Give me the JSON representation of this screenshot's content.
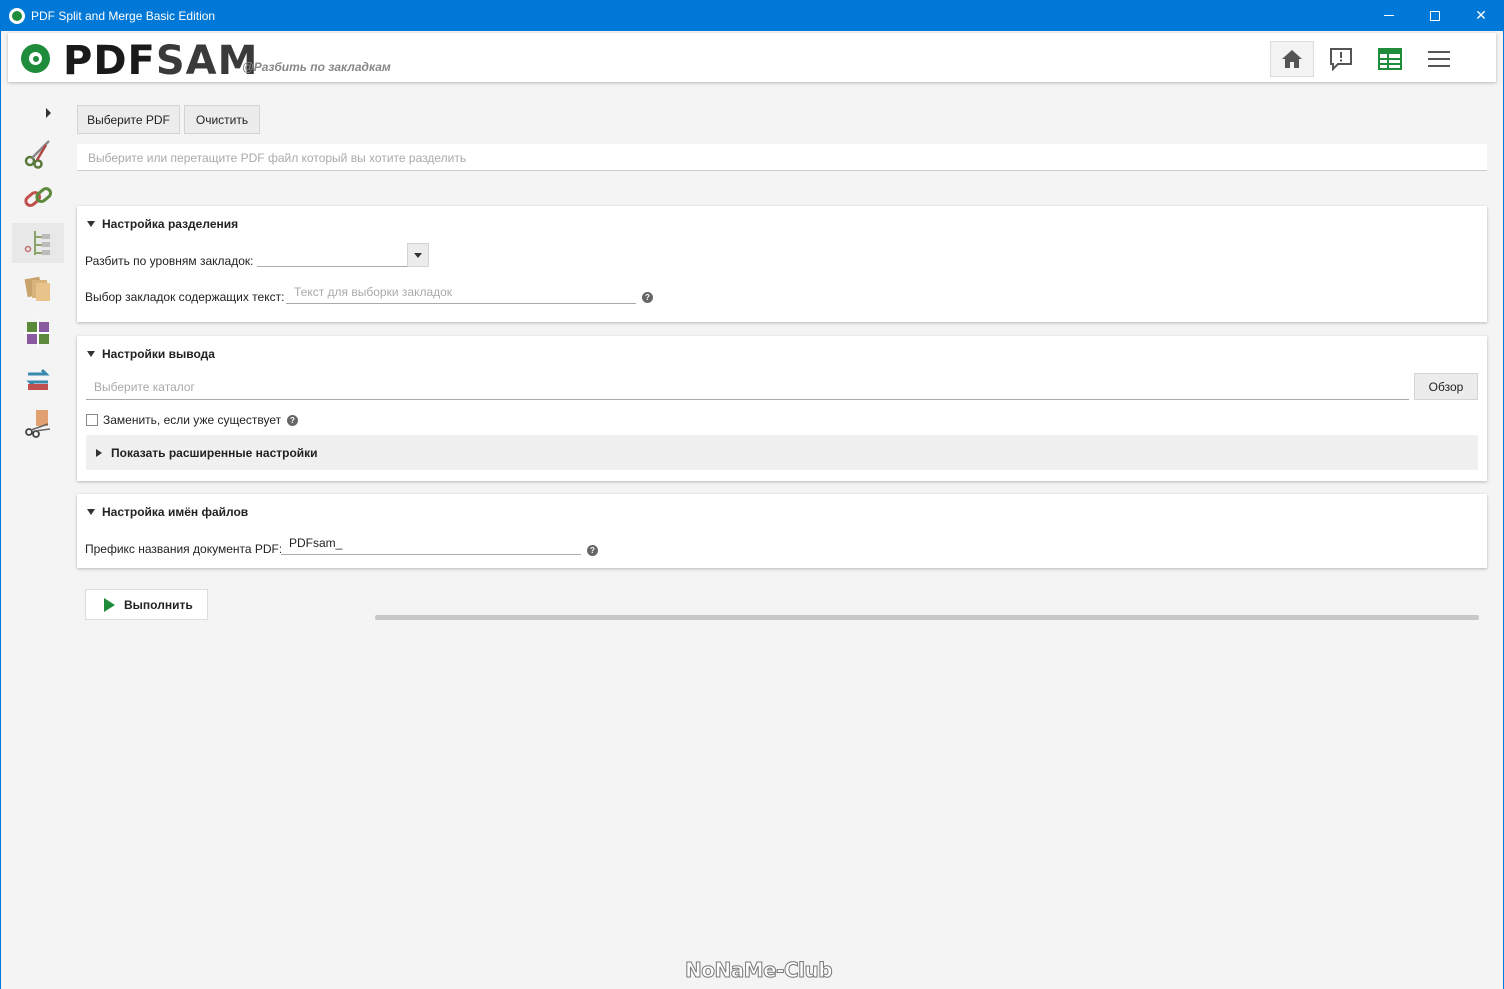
{
  "window": {
    "title": "PDF Split and Merge Basic Edition",
    "controls": {
      "minimize": "",
      "maximize": "",
      "close": "✕"
    }
  },
  "header": {
    "logo_pdf": "PDF",
    "logo_sam": "SAM",
    "module": "@Разбить по закладкам",
    "buttons": [
      "home-icon",
      "news-icon",
      "workspace-icon",
      "menu-icon"
    ],
    "accent": "#1e8c3a"
  },
  "sidebar": {
    "items": [
      "split-icon",
      "merge-icon",
      "split-by-bookmarks-icon",
      "alternate-mix-icon",
      "rotate-icon",
      "extract-icon",
      "split-by-size-icon"
    ],
    "active_index": 2
  },
  "input": {
    "select_pdf": "Выберите PDF",
    "clear": "Очистить",
    "placeholder": "Выберите или перетащите PDF файл который вы хотите разделить"
  },
  "split_settings": {
    "title": "Настройка разделения",
    "level_label": "Разбить по уровням закладок:",
    "level_value": "",
    "regex_label": "Выбор закладок содержащих текст:",
    "regex_placeholder": "Текст для выборки закладок"
  },
  "output_settings": {
    "title": "Настройки вывода",
    "dir_placeholder": "Выберите каталог",
    "browse": "Обзор",
    "overwrite_label": "Заменить, если уже существует",
    "overwrite_checked": false,
    "advanced": "Показать расширенные настройки"
  },
  "filename_settings": {
    "title": "Настройка имён файлов",
    "prefix_label": "Префикс названия документа PDF:",
    "prefix_value": "PDFsam_"
  },
  "run": {
    "label": "Выполнить",
    "progress": 0
  },
  "watermark": "NoNaMe-Club"
}
